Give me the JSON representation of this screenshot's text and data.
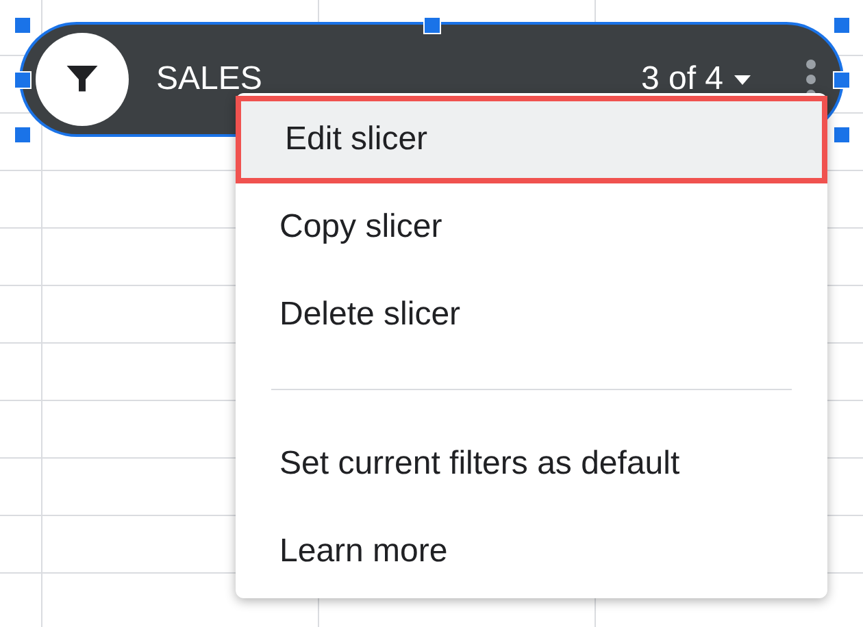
{
  "slicer": {
    "title": "SALES",
    "filter_status": "3 of 4",
    "selected": true
  },
  "menu": {
    "items": [
      {
        "kind": "item",
        "label": "Edit slicer",
        "selected": true
      },
      {
        "kind": "item",
        "label": "Copy slicer",
        "selected": false
      },
      {
        "kind": "item",
        "label": "Delete slicer",
        "selected": false
      },
      {
        "kind": "divider"
      },
      {
        "kind": "item",
        "label": "Set current filters as default",
        "selected": false
      },
      {
        "kind": "item",
        "label": "Learn more",
        "selected": false
      }
    ]
  }
}
